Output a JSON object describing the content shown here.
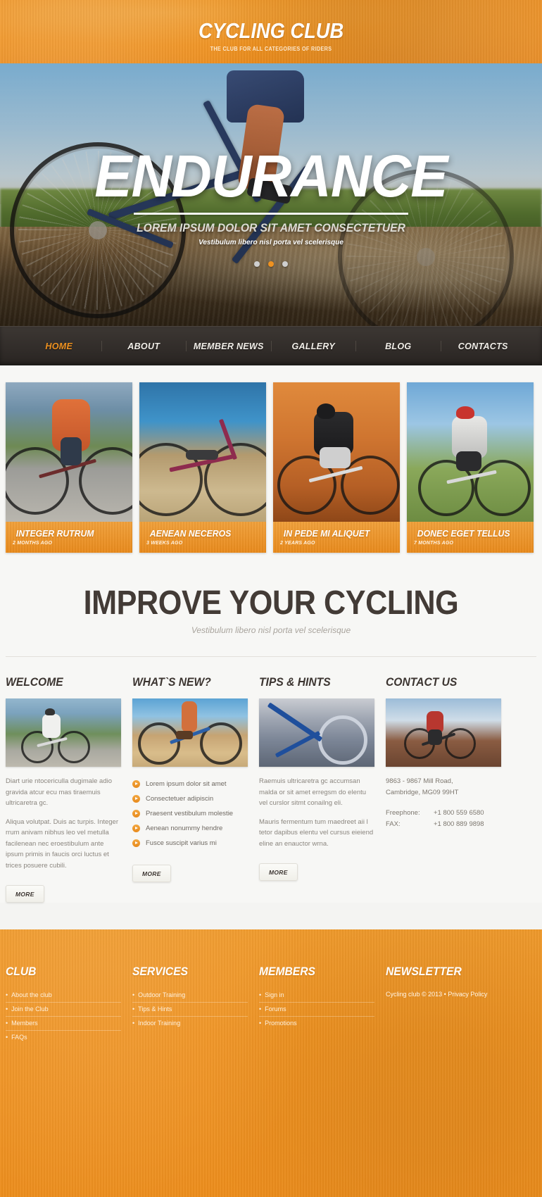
{
  "header": {
    "logo_title": "CYCLING CLUB",
    "logo_tagline": "THE CLUB FOR ALL CATEGORIES OF RIDERS"
  },
  "hero": {
    "title": "ENDURANCE",
    "subtitle": "LOREM IPSUM DOLOR SIT AMET CONSECTETUER",
    "subtitle2": "Vestibulum libero nisl porta vel scelerisque",
    "slides": 3,
    "active_slide": 2
  },
  "nav": {
    "items": [
      {
        "label": "HOME",
        "active": true
      },
      {
        "label": "ABOUT",
        "active": false
      },
      {
        "label": "MEMBER NEWS",
        "active": false
      },
      {
        "label": "GALLERY",
        "active": false
      },
      {
        "label": "BLOG",
        "active": false
      },
      {
        "label": "CONTACTS",
        "active": false
      }
    ]
  },
  "gallery": {
    "cards": [
      {
        "title": "INTEGER RUTRUM",
        "date": "2 MONTHS AGO"
      },
      {
        "title": "AENEAN NECEROS",
        "date": "3 WEEKS AGO"
      },
      {
        "title": "IN PEDE MI ALIQUET",
        "date": "2 YEARS AGO"
      },
      {
        "title": "DONEC EGET TELLUS",
        "date": "7 MONTHS AGO"
      }
    ]
  },
  "improve": {
    "heading": "IMPROVE YOUR CYCLING",
    "subheading": "Vestibulum libero nisl porta vel scelerisque"
  },
  "columns": {
    "welcome": {
      "heading": "WELCOME",
      "paragraph1": "Diart urie ntocericulla dugimale adio gravida atcur ecu mas tiraemuis ultricaretra gc.",
      "paragraph2": "Aliqua volutpat. Duis ac turpis. Integer rrum anivam nibhus leo vel metulla facilenean nec eroestibulum ante ipsum primis in faucis orci luctus et trices posuere cubili.",
      "more_label": "MORE"
    },
    "whats_new": {
      "heading": "WHAT`S NEW?",
      "items": [
        "Lorem ipsum dolor sit amet",
        "Consectetuer adipiscin",
        "Praesent vestibulum molestie",
        "Aenean nonummy hendre",
        "Fusce suscipit varius mi"
      ],
      "more_label": "MORE"
    },
    "tips": {
      "heading": "TIPS & HINTS",
      "paragraph1": "Raemuis ultricaretra gc accumsan malda or sit amet erregsm do elentu vel curslor sitmt conailng eli.",
      "paragraph2": "Mauris fermentum tum maedreet aii l tetor dapibus elentu vel cursus eieiend eline an enauctor wrna.",
      "more_label": "MORE"
    },
    "contact": {
      "heading": "CONTACT US",
      "address_line1": "9863 - 9867 Mill Road,",
      "address_line2": "Cambridge, MG09 99HT",
      "rows": [
        {
          "label": "Freephone:",
          "value": "+1 800 559 6580"
        },
        {
          "label": "FAX:",
          "value": "+1 800 889 9898"
        }
      ]
    }
  },
  "footer": {
    "club": {
      "heading": "CLUB",
      "links": [
        "About the club",
        "Join the Club",
        "Members",
        "FAQs"
      ]
    },
    "services": {
      "heading": "SERVICES",
      "links": [
        "Outdoor Training",
        "Tips & Hints",
        "Indoor Training"
      ]
    },
    "members": {
      "heading": "MEMBERS",
      "links": [
        "Sign in",
        "Forums",
        "Promotions"
      ]
    },
    "newsletter": {
      "heading": "NEWSLETTER",
      "copyright": "Cycling club © 2013 • Privacy Policy"
    }
  },
  "colors": {
    "orange": "#ef9220",
    "dark": "#322d2a",
    "text": "#7d776f"
  }
}
